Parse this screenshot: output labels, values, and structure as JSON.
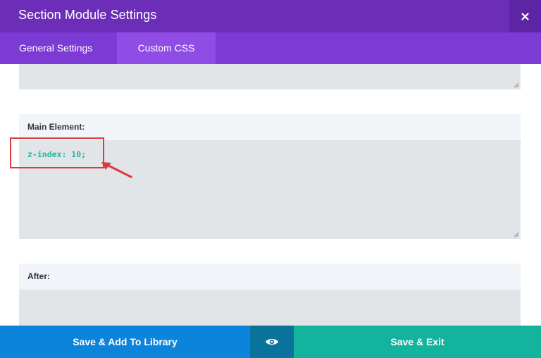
{
  "header": {
    "title": "Section Module Settings",
    "close_icon": "close-icon"
  },
  "tabs": [
    {
      "label": "General Settings",
      "active": false
    },
    {
      "label": "Custom CSS",
      "active": true
    }
  ],
  "fields": {
    "main_element": {
      "label": "Main Element:",
      "value": "z-index: 10;"
    },
    "after": {
      "label": "After:",
      "value": ""
    }
  },
  "footer": {
    "save_library_label": "Save & Add To Library",
    "preview_icon": "eye-icon",
    "save_exit_label": "Save & Exit"
  },
  "colors": {
    "header_bg": "#6c2eb9",
    "tabs_bg": "#7c3bd5",
    "active_tab_bg": "#8f4de6",
    "library_btn": "#0c84dc",
    "preview_btn": "#09739b",
    "exit_btn": "#13b39d",
    "code_text": "#2ab3a0",
    "highlight": "#e0393e"
  }
}
